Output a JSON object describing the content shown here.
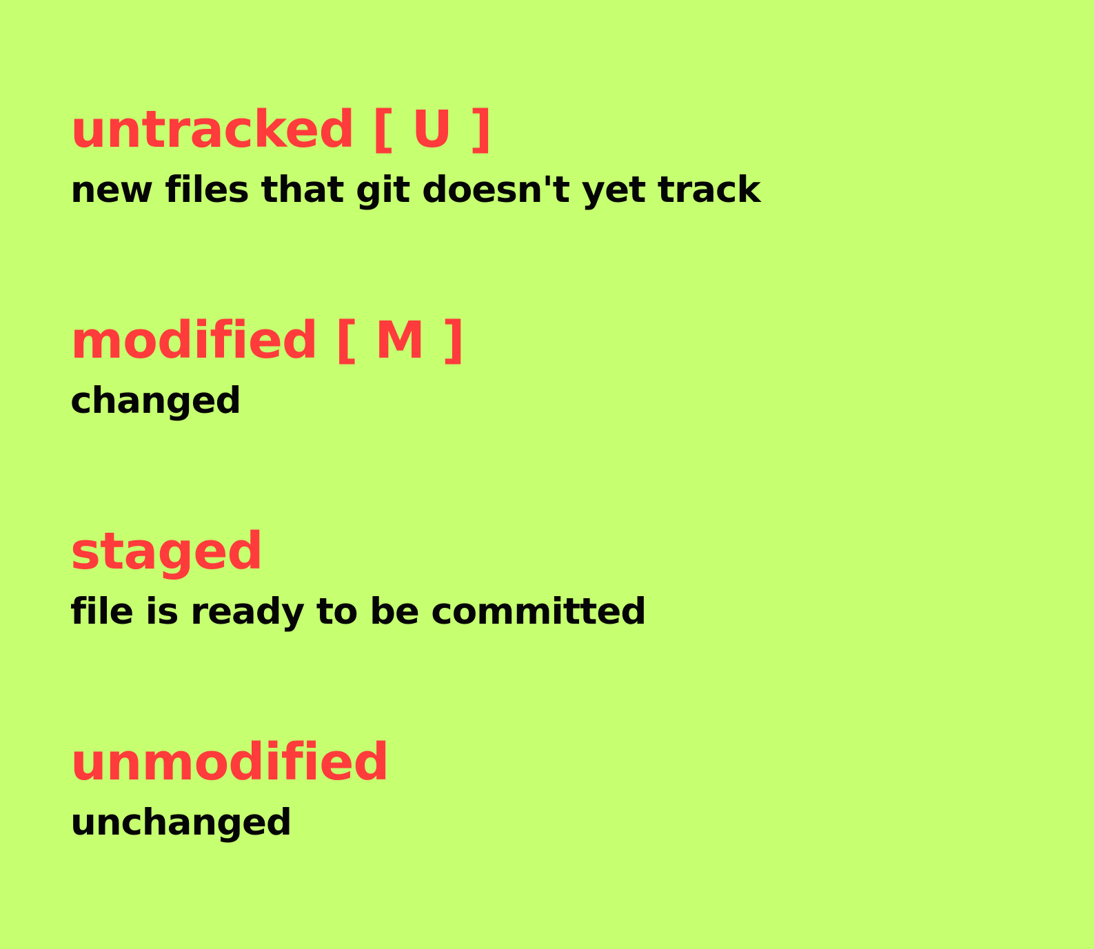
{
  "colors": {
    "background": "#c6ff70",
    "title": "#ff3b3b",
    "description": "#050505"
  },
  "statuses": [
    {
      "title": "untracked [ U ]",
      "description": "new files that git doesn't yet track"
    },
    {
      "title": "modified [ M ]",
      "description": "changed"
    },
    {
      "title": "staged",
      "description": "file is ready to be committed"
    },
    {
      "title": "unmodified",
      "description": "unchanged"
    }
  ]
}
